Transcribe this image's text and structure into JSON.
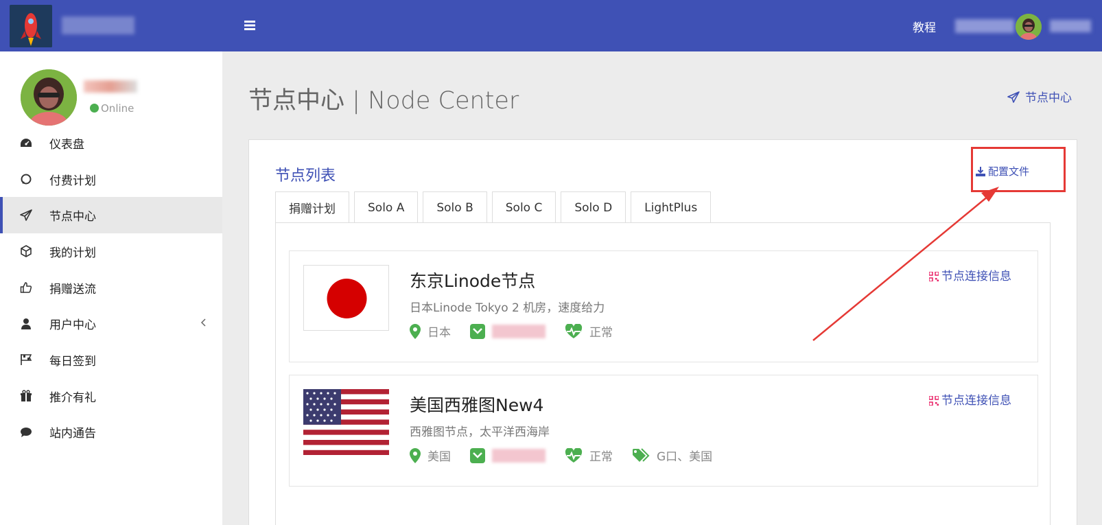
{
  "header": {
    "menu_icon": "bars-icon",
    "tutorial_link": "教程",
    "colors": {
      "primary": "#3f51b5"
    }
  },
  "sidebar": {
    "status": "Online",
    "items": [
      {
        "label": "仪表盘",
        "icon": "dashboard-icon"
      },
      {
        "label": "付费计划",
        "icon": "refresh-icon"
      },
      {
        "label": "节点中心",
        "icon": "paper-plane-icon",
        "active": true
      },
      {
        "label": "我的计划",
        "icon": "cube-icon"
      },
      {
        "label": "捐赠送流",
        "icon": "thumbs-up-icon"
      },
      {
        "label": "用户中心",
        "icon": "user-icon",
        "has_submenu": true
      },
      {
        "label": "每日签到",
        "icon": "flag-checkered-icon"
      },
      {
        "label": "推介有礼",
        "icon": "gift-icon"
      },
      {
        "label": "站内通告",
        "icon": "comment-icon"
      }
    ]
  },
  "main": {
    "page_title": "节点中心 | Node Center",
    "breadcrumb": "节点中心",
    "card": {
      "title": "节点列表",
      "config_button": "配置文件",
      "tabs": [
        "捐赠计划",
        "Solo A",
        "Solo B",
        "Solo C",
        "Solo D",
        "LightPlus"
      ],
      "nodes": [
        {
          "name": "东京Linode节点",
          "description": "日本Linode Tokyo 2 机房，速度给力",
          "flag": "japan-flag",
          "location": "日本",
          "status": "正常",
          "connect_label": "节点连接信息"
        },
        {
          "name": "美国西雅图New4",
          "description": "西雅图节点，太平洋西海岸",
          "flag": "usa-flag",
          "location": "美国",
          "status": "正常",
          "tags": "G口、美国",
          "connect_label": "节点连接信息"
        }
      ]
    }
  }
}
